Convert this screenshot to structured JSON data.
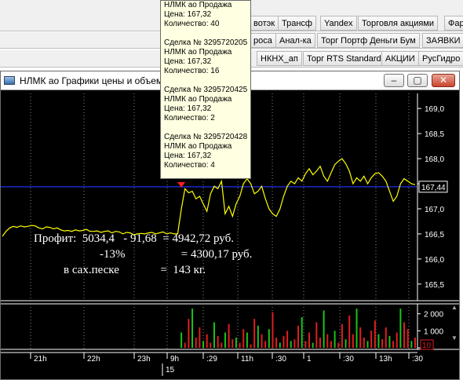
{
  "tabs_row1": [
    "вотэк",
    "Трансф",
    "Yandex",
    "Торговля акциями",
    "Фар"
  ],
  "tabs_row2": [
    "роса",
    "Анал-ка",
    "Торг Портф Деньги Бум",
    "ЗАЯВКИ"
  ],
  "tabs_row3": [
    "НКНХ_ап",
    "Торг RTS Standard",
    "АКЦИИ",
    "РусГидро"
  ],
  "window": {
    "title": "НЛМК ао Графики цены и объема",
    "minimize": "–",
    "maximize": "▢",
    "close": "✕"
  },
  "tooltip": {
    "trades": [
      {
        "lines": [
          "НЛМК ао Продажа",
          "Цена: 167,32",
          "Количество: 40"
        ]
      },
      {
        "lines": [
          "Сделка № 3295720205",
          "НЛМК ао Продажа",
          "Цена: 167,32",
          "Количество: 16"
        ]
      },
      {
        "lines": [
          "Сделка № 3295720425",
          "НЛМК ао Продажа",
          "Цена: 167,32",
          "Количество: 2"
        ]
      },
      {
        "lines": [
          "Сделка № 3295720428",
          "НЛМК ао Продажа",
          "Цена: 167,32",
          "Количество: 4"
        ]
      }
    ]
  },
  "overlay": {
    "line1": "Профит:  5034,4   - 91,68  = 4942,72 руб.",
    "line2": "-13%                   = 4300,17 руб.",
    "line3": "в сах.песке              =  143 кг."
  },
  "chart_data": {
    "type": "line",
    "price_axis_ticks": [
      "169,0",
      "168,5",
      "168,0",
      "167,5",
      "167,0",
      "166,5",
      "166,0",
      "165,5"
    ],
    "last_price_label": "167,44",
    "volume_axis_ticks": [
      "2 000",
      "1 000",
      "0"
    ],
    "volume_last_label": "10",
    "time_ticks": [
      "21h",
      "22h",
      "23h",
      "9h",
      ":29",
      "11h",
      ":30",
      "1",
      ":30",
      "13h",
      ":30"
    ],
    "date_label": "15",
    "colors": {
      "price_line": "#ffff00",
      "level_line": "#1a28c8",
      "buy_volume": "#19c319",
      "sell_volume": "#e01e1e",
      "marker": "#ff2020"
    },
    "price_range": [
      165.2,
      169.3
    ],
    "level_price": 167.44,
    "series": [
      {
        "values": [
          166.45,
          166.55,
          166.62,
          166.65,
          166.63,
          166.66,
          166.64,
          166.65,
          166.67,
          166.66,
          166.62,
          166.6,
          166.64,
          166.63,
          166.6,
          166.62,
          166.58,
          166.56,
          166.57,
          166.55,
          166.58,
          166.56,
          166.57,
          166.59,
          166.55,
          166.55,
          166.56,
          166.53,
          166.55,
          166.56,
          166.52,
          166.55,
          166.54,
          166.5,
          166.53,
          166.52,
          166.48,
          166.5,
          166.51,
          166.5,
          166.52,
          166.53,
          166.5,
          166.52,
          166.54,
          166.5,
          166.52,
          166.5,
          166.5,
          167.0,
          167.4,
          167.32,
          167.35,
          167.2,
          167.25,
          167.1,
          166.95,
          167.3,
          167.45,
          167.4,
          167.55,
          166.9,
          167.05,
          166.85,
          167.1,
          167.25,
          167.5,
          167.6,
          167.5,
          167.3,
          167.35,
          167.45,
          167.2,
          167.0,
          166.9,
          166.85,
          167.0,
          167.25,
          167.45,
          167.55,
          167.5,
          167.62,
          167.55,
          167.7,
          167.8,
          167.68,
          167.75,
          167.85,
          167.65,
          167.55,
          167.72,
          167.88,
          167.95,
          168.0,
          167.9,
          167.75,
          167.5,
          167.62,
          167.55,
          167.65,
          167.5,
          167.62,
          167.7,
          167.72,
          167.65,
          167.55,
          167.35,
          167.15,
          167.25,
          167.5,
          167.6,
          167.55,
          167.5,
          167.48
        ]
      }
    ],
    "volume_series": [
      {
        "values": [
          0,
          0,
          0,
          0,
          0,
          0,
          0,
          0,
          0,
          0,
          0,
          0,
          0,
          0,
          0,
          0,
          0,
          0,
          0,
          0,
          0,
          0,
          0,
          0,
          0,
          0,
          0,
          0,
          0,
          0,
          0,
          0,
          0,
          0,
          0,
          0,
          0,
          0,
          0,
          0,
          0,
          0,
          0,
          0,
          0,
          0,
          0,
          0,
          0,
          900,
          300,
          1700,
          2300,
          600,
          1200,
          400,
          800,
          300,
          1500,
          700,
          300,
          900,
          1400,
          500,
          600,
          300,
          1100,
          900,
          200,
          1700,
          1300,
          800,
          400,
          1100,
          2100,
          600,
          300,
          700,
          1000,
          400,
          500,
          1300,
          1800,
          400,
          900,
          300,
          1500,
          600,
          2200,
          800,
          400,
          1000,
          300,
          1400,
          500,
          1900,
          800,
          2300,
          1200,
          600,
          400,
          1000,
          1600,
          800,
          500,
          1200,
          700,
          400,
          900,
          2300,
          1500,
          1100,
          400,
          600
        ]
      }
    ]
  }
}
